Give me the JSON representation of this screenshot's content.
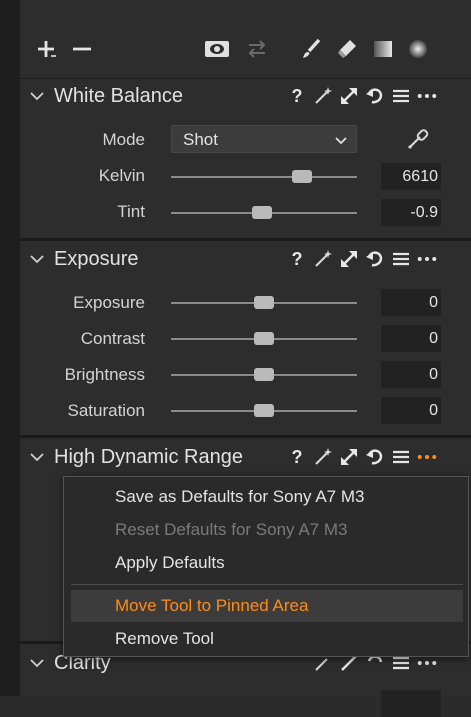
{
  "toolbar": {
    "icons": [
      "plus-icon",
      "minus-icon",
      "eye-icon",
      "swap-icon",
      "brush-icon",
      "eraser-icon",
      "gradient-icon",
      "radial-icon"
    ]
  },
  "white_balance": {
    "title": "White Balance",
    "mode_label": "Mode",
    "mode_value": "Shot",
    "kelvin_label": "Kelvin",
    "kelvin_value": "6610",
    "kelvin_level": 0.73,
    "tint_label": "Tint",
    "tint_value": "-0.9",
    "tint_level": 0.49
  },
  "exposure": {
    "title": "Exposure",
    "rows": [
      {
        "label": "Exposure",
        "value": "0",
        "level": 0.5
      },
      {
        "label": "Contrast",
        "value": "0",
        "level": 0.5
      },
      {
        "label": "Brightness",
        "value": "0",
        "level": 0.5
      },
      {
        "label": "Saturation",
        "value": "0",
        "level": 0.5
      }
    ]
  },
  "hdr": {
    "title": "High Dynamic Range"
  },
  "clarity": {
    "title": "Clarity"
  },
  "context_menu": {
    "items": [
      {
        "label": "Save as Defaults for Sony A7 M3",
        "state": "normal"
      },
      {
        "label": "Reset Defaults for Sony A7 M3",
        "state": "disabled"
      },
      {
        "label": "Apply Defaults",
        "state": "normal"
      },
      {
        "label": "Move Tool to Pinned Area",
        "state": "highlighted"
      },
      {
        "label": "Remove Tool",
        "state": "normal"
      }
    ]
  },
  "colors": {
    "accent": "#ff8c1a",
    "disabled": "#7a7a7a",
    "text": "#d8d8d8"
  }
}
